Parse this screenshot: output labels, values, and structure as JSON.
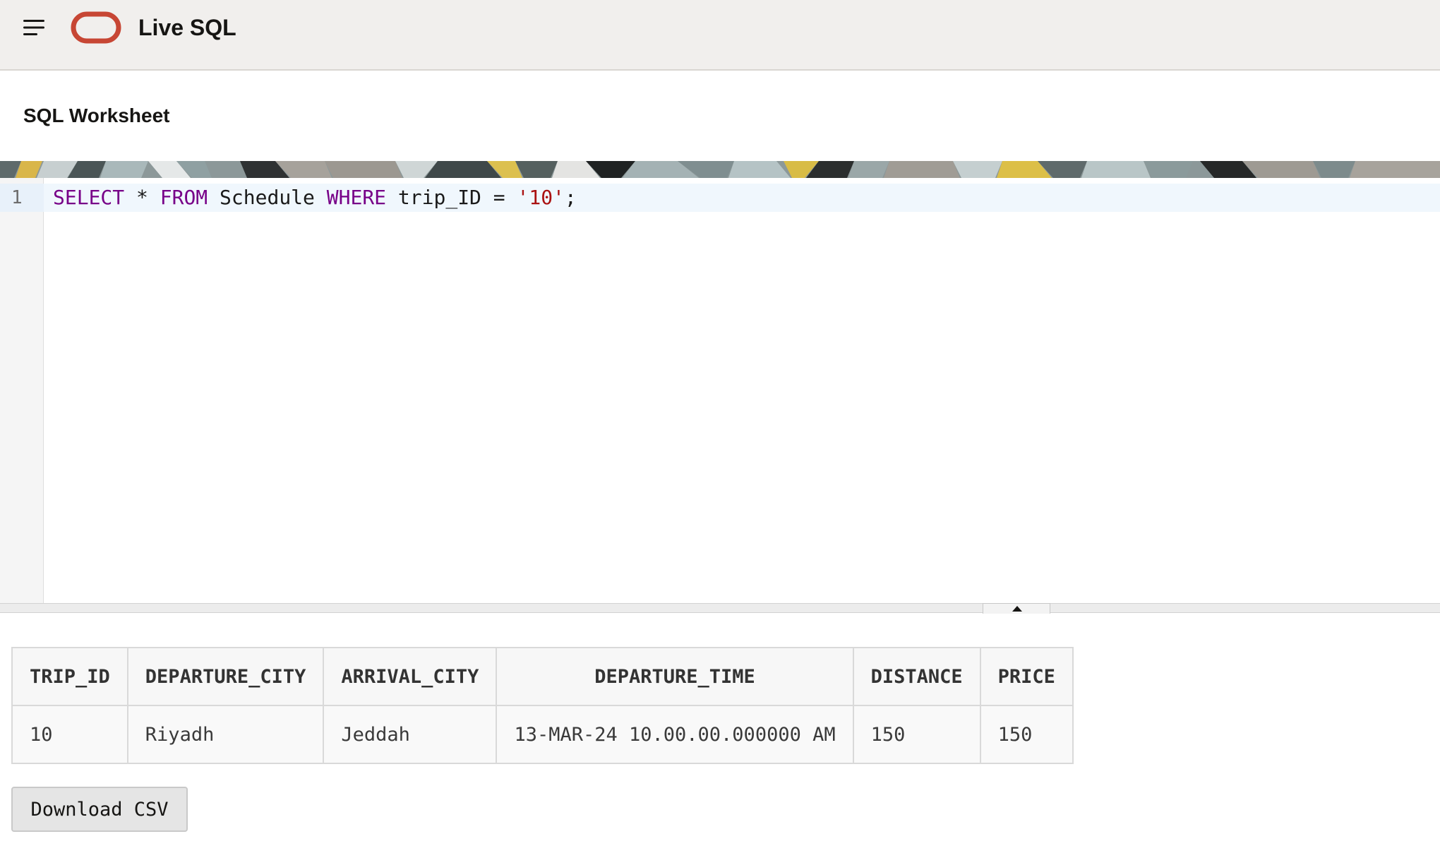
{
  "header": {
    "app_title": "Live SQL",
    "menu_icon": "hamburger-menu-icon",
    "logo_icon": "oracle-logo-icon",
    "logo_color": "#c74634"
  },
  "worksheet": {
    "title": "SQL Worksheet"
  },
  "editor": {
    "line_number": "1",
    "tokens": {
      "select": "SELECT",
      "star": " * ",
      "from": "FROM",
      "table": " Schedule ",
      "where": "WHERE",
      "condition": " trip_ID = ",
      "literal": "'10'",
      "terminator": ";"
    },
    "keyword_color": "#770088",
    "string_color": "#aa1111"
  },
  "splitter": {
    "toggle_icon": "caret-up-icon"
  },
  "results": {
    "columns": [
      "TRIP_ID",
      "DEPARTURE_CITY",
      "ARRIVAL_CITY",
      "DEPARTURE_TIME",
      "DISTANCE",
      "PRICE"
    ],
    "rows": [
      [
        "10",
        "Riyadh",
        "Jeddah",
        "13-MAR-24 10.00.00.000000 AM",
        "150",
        "150"
      ]
    ]
  },
  "actions": {
    "download_label": "Download CSV"
  }
}
